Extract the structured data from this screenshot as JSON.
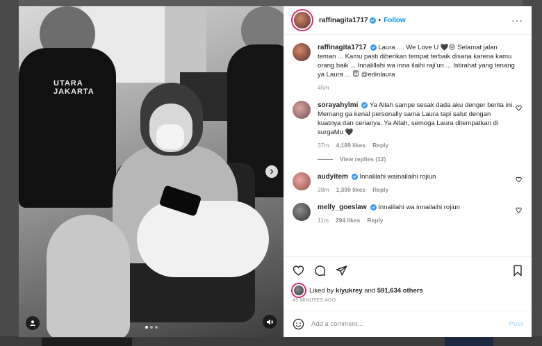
{
  "post": {
    "author": "raffinagita1717",
    "follow_label": "Follow",
    "separator": "•",
    "more_label": "···",
    "shirt_text": "UTARA\nJAKARTA"
  },
  "caption": {
    "username": "raffinagita1717",
    "text": "Laura .... We Love U 🖤😔 Selamat jalan teman ... Kamu pasti diberikan tempat terbaik disana karena kamu orang baik ... Innalillahi wa inna ilaihi raji'un ... Istirahat yang tenang ya Laura ... 😇 @edinlaura",
    "time": "45m"
  },
  "comments": [
    {
      "username": "sorayahylmi",
      "text": "Ya Allah sampe sesak dada aku denger berita ini. Memang ga kenal personally sama Laura tapi salut dengan kuatnya dan cerianya. Ya Allah, semoga Laura ditempatkan di surgaMu 🖤",
      "time": "37m",
      "likes": "4,189 likes",
      "reply_label": "Reply",
      "view_replies": "View replies (12)"
    },
    {
      "username": "audyitem",
      "text": "Innalilahi wainailaihi rojiun",
      "time": "28m",
      "likes": "1,390 likes",
      "reply_label": "Reply"
    },
    {
      "username": "melly_goeslaw",
      "text": "Innalilahi wa innailaihi rojiun",
      "time": "11m",
      "likes": "294 likes",
      "reply_label": "Reply"
    }
  ],
  "likes_line": {
    "prefix": "Liked by ",
    "user": "kiyukrey",
    "middle": " and ",
    "count": "591,634 others"
  },
  "timestamp": "45 MINUTES AGO",
  "composer": {
    "placeholder": "Add a comment...",
    "post_label": "Post"
  },
  "colors": {
    "accent": "#0095f6",
    "verified": "#3897f0",
    "muted": "#8e8e8e"
  }
}
